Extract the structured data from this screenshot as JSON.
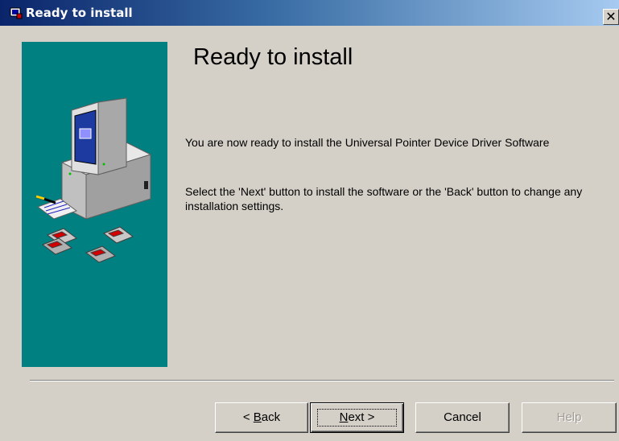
{
  "window": {
    "title": "Ready to install",
    "close_glyph": "✕"
  },
  "main": {
    "heading": "Ready to install",
    "paragraph1": "You are now ready to install the Universal Pointer Device Driver Software",
    "paragraph2": "Select the 'Next' button to install the software or the 'Back' button to change any installation settings."
  },
  "buttons": {
    "back": {
      "prefix": "< ",
      "accel": "B",
      "rest": "ack"
    },
    "next": {
      "accel": "N",
      "rest": "ext >"
    },
    "cancel": "Cancel",
    "help": "Help"
  },
  "colors": {
    "panel": "#008080",
    "dialog": "#d4d0c8",
    "titlebar_start": "#0a246a",
    "titlebar_end": "#a6caf0"
  },
  "icons": {
    "title": "setup-window-icon",
    "illustration": "computer-with-disks-illustration"
  }
}
